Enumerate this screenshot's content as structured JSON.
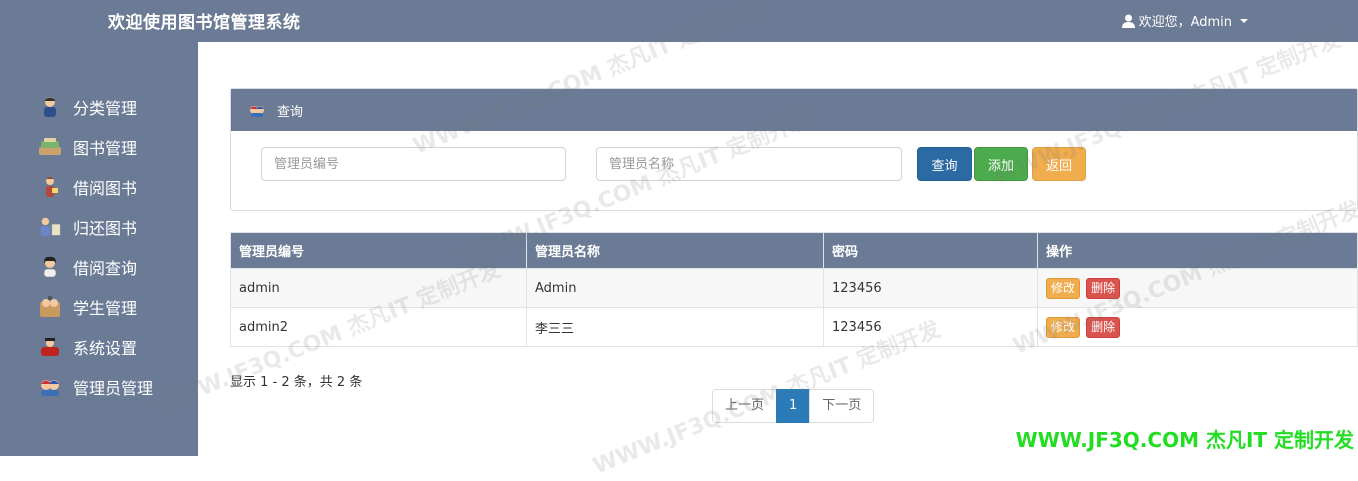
{
  "header": {
    "title": "欢迎使用图书馆管理系统",
    "user_greeting": "欢迎您，Admin"
  },
  "sidebar": {
    "items": [
      {
        "label": "分类管理",
        "icon": "person-blue-icon"
      },
      {
        "label": "图书管理",
        "icon": "books-icon"
      },
      {
        "label": "借阅图书",
        "icon": "person-reading-icon"
      },
      {
        "label": "归还图书",
        "icon": "person-return-icon"
      },
      {
        "label": "借阅查询",
        "icon": "person-search-icon"
      },
      {
        "label": "学生管理",
        "icon": "students-icon"
      },
      {
        "label": "系统设置",
        "icon": "settings-red-icon"
      },
      {
        "label": "管理员管理",
        "icon": "admins-icon"
      }
    ]
  },
  "search_panel": {
    "title": "查询",
    "id_placeholder": "管理员编号",
    "name_placeholder": "管理员名称",
    "id_value": "",
    "name_value": "",
    "query_label": "查询",
    "add_label": "添加",
    "back_label": "返回"
  },
  "table": {
    "headers": [
      "管理员编号",
      "管理员名称",
      "密码",
      "操作"
    ],
    "rows": [
      {
        "id": "admin",
        "name": "Admin",
        "password": "123456",
        "edit": "修改",
        "delete": "删除"
      },
      {
        "id": "admin2",
        "name": "李三三",
        "password": "123456",
        "edit": "修改",
        "delete": "删除"
      }
    ]
  },
  "pagination": {
    "summary": "显示 1 - 2 条，共 2 条",
    "prev": "上一页",
    "current": "1",
    "next": "下一页"
  },
  "watermark": {
    "texts": [
      "WWW.JF3Q.COM 杰凡IT 定制开发"
    ],
    "brand": "WWW.JF3Q.COM 杰凡IT  定制开发"
  },
  "colors": {
    "header": "#6b7b95",
    "primary": "#2b6aa3",
    "success": "#4cab4c",
    "warning": "#f0ad4e",
    "danger": "#d9534f",
    "brand_green": "#22dd22"
  }
}
